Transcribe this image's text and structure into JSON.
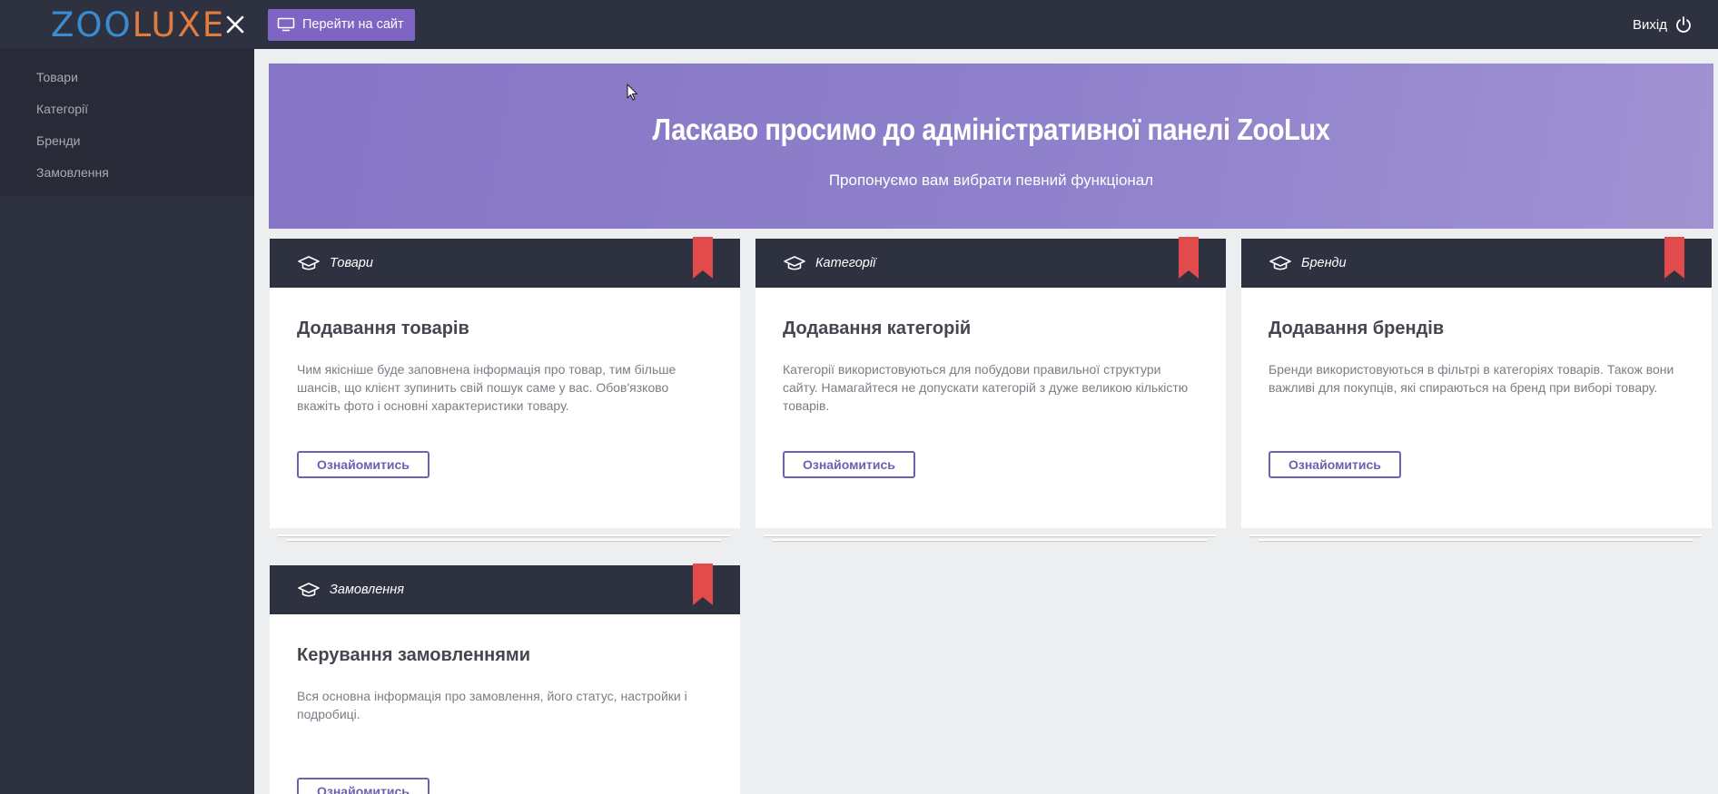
{
  "sidebar": {
    "logo_part1": "ZOO",
    "logo_part2": "LUXE",
    "items": [
      {
        "label": "Товари"
      },
      {
        "label": "Категорії"
      },
      {
        "label": "Бренди"
      },
      {
        "label": "Замовлення"
      }
    ]
  },
  "topbar": {
    "site_button": "Перейти на сайт",
    "logout": "Вихід"
  },
  "banner": {
    "title": "Ласкаво просимо до адміністративної панелі ZooLux",
    "subtitle": "Пропонуємо вам вибрати певний функціонал"
  },
  "cards": [
    {
      "category": "Товари",
      "title": "Додавання товарів",
      "text": "Чим якісніше буде заповнена інформація про товар, тим більше шансів, що клієнт зупинить свій пошук саме у вас. Обов'язково вкажіть фото і основні характеристики товару.",
      "button": "Ознайомитись"
    },
    {
      "category": "Категорії",
      "title": "Додавання категорій",
      "text": "Категорії використовуються для побудови правильної структури сайту. Намагайтеся не допускати категорій з дуже великою кількістю товарів.",
      "button": "Ознайомитись"
    },
    {
      "category": "Бренди",
      "title": "Додавання брендів",
      "text": "Бренди використовуються в фільтрі в категоріях товарів. Також вони важливі для покупців, які спираються на бренд при виборі товару.",
      "button": "Ознайомитись"
    },
    {
      "category": "Замовлення",
      "title": "Керування замовленнями",
      "text": "Вся основна інформація про замовлення, його статус, настройки і подробиці.",
      "button": "Ознайомитись"
    }
  ],
  "colors": {
    "sidebar_bg": "#2e3140",
    "accent": "#7e65c3",
    "ribbon": "#e14b4b"
  }
}
